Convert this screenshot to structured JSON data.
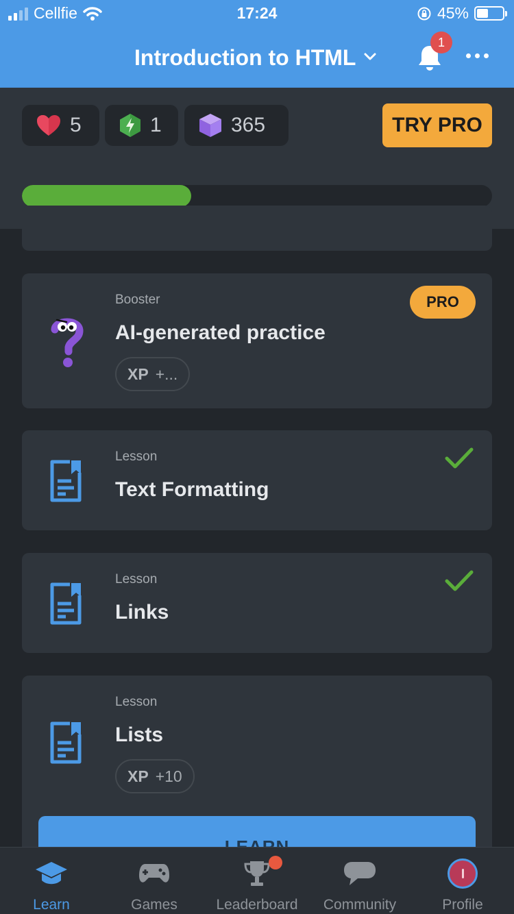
{
  "status_bar": {
    "carrier": "Cellfie",
    "time": "17:24",
    "battery": "45%",
    "battery_level": 0.45
  },
  "header": {
    "title": "Introduction to HTML",
    "notification_count": "1"
  },
  "stats": {
    "hearts": "5",
    "energy": "1",
    "gems": "365",
    "try_pro_label": "TRY PRO"
  },
  "progress": {
    "value": 0.36
  },
  "cards": [
    {
      "type": "Booster",
      "title": "AI-generated practice",
      "xp_label": "XP",
      "xp_value": "+...",
      "badge": "PRO"
    },
    {
      "type": "Lesson",
      "title": "Text Formatting",
      "completed": true
    },
    {
      "type": "Lesson",
      "title": "Links",
      "completed": true
    },
    {
      "type": "Lesson",
      "title": "Lists",
      "xp_label": "XP",
      "xp_value": "+10",
      "button": "LEARN"
    }
  ],
  "tabs": [
    {
      "label": "Learn",
      "icon": "graduation-cap-icon",
      "active": true
    },
    {
      "label": "Games",
      "icon": "gamepad-icon"
    },
    {
      "label": "Leaderboard",
      "icon": "trophy-icon"
    },
    {
      "label": "Community",
      "icon": "chat-bubble-icon"
    },
    {
      "label": "Profile",
      "icon": "avatar"
    }
  ],
  "colors": {
    "header": "#4c9ae6",
    "accent_orange": "#f3a93c",
    "progress_green": "#5aad3a",
    "check_green": "#5aad3a",
    "background": "#22262b",
    "card": "#2f353c"
  }
}
